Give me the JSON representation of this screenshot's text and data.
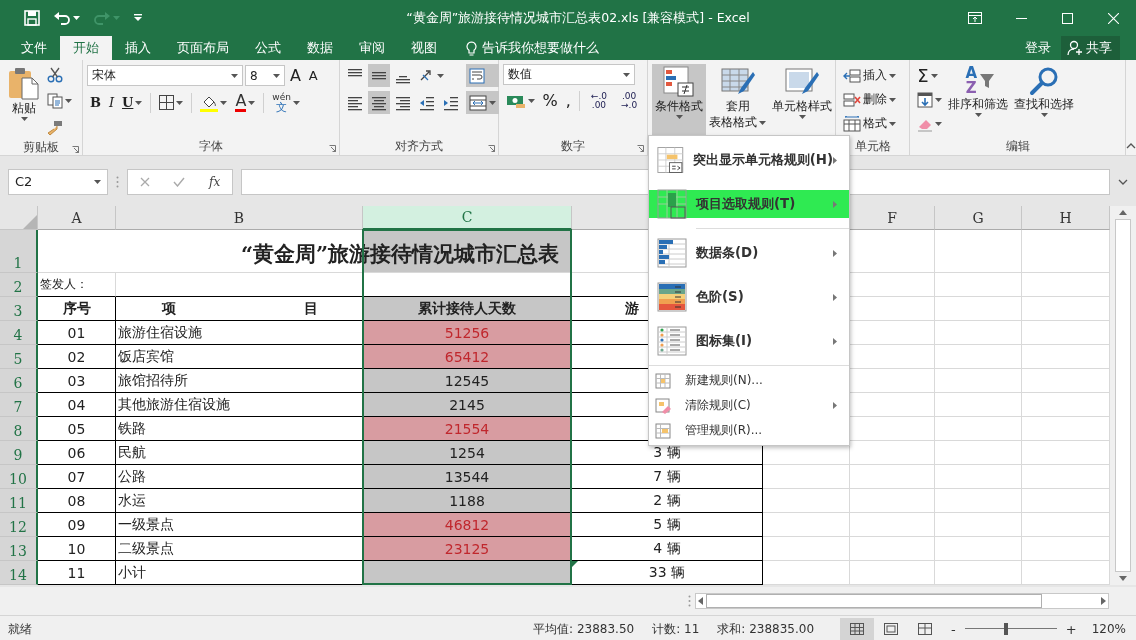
{
  "title_bar": {
    "title": "“黄金周”旅游接待情况城市汇总表02.xls  [兼容模式] - Excel"
  },
  "ribbon_tabs": [
    {
      "label": "文件",
      "selected": false
    },
    {
      "label": "开始",
      "selected": true
    },
    {
      "label": "插入",
      "selected": false
    },
    {
      "label": "页面布局",
      "selected": false
    },
    {
      "label": "公式",
      "selected": false
    },
    {
      "label": "数据",
      "selected": false
    },
    {
      "label": "审阅",
      "selected": false
    },
    {
      "label": "视图",
      "selected": false
    }
  ],
  "tell_me": "告诉我你想要做什么",
  "sign_in": "登录",
  "share": "共享",
  "ribbon": {
    "clipboard": {
      "paste": "粘贴",
      "group": "剪贴板"
    },
    "font": {
      "name": "宋体",
      "size": "8",
      "grow": "A",
      "shrink": "A",
      "bold": "B",
      "italic": "I",
      "underline": "U",
      "font_color": "A",
      "phonetic_top": "wén",
      "phonetic_bottom": "文",
      "group": "字体"
    },
    "alignment": {
      "top_row": [
        {
          "kind": "align-top",
          "pressed": false
        },
        {
          "kind": "align-middle",
          "pressed": true
        },
        {
          "kind": "align-bottom",
          "pressed": false
        },
        {
          "kind": "orientation",
          "pressed": false
        }
      ],
      "bottom_row": [
        {
          "kind": "align-left",
          "pressed": false
        },
        {
          "kind": "align-center",
          "pressed": true
        },
        {
          "kind": "align-right",
          "pressed": false
        },
        {
          "kind": "outdent",
          "pressed": false
        },
        {
          "kind": "indent",
          "pressed": false
        }
      ],
      "wrap_text": {
        "pressed": true
      },
      "merge": {
        "pressed": true
      },
      "group": "对齐方式"
    },
    "number": {
      "format": "数值",
      "percent": "%",
      "comma": ",",
      "decimal_increase": [
        "←.0",
        ".00"
      ],
      "decimal_decrease": [
        ".00",
        "→.0"
      ],
      "group": "数字"
    },
    "styles": {
      "conditional": "条件格式",
      "conditional_pressed": true,
      "table_top": "套用",
      "table_bottom": "表格格式",
      "cell_styles": "单元格样式"
    },
    "cells": {
      "insert": "插入",
      "delete": "删除",
      "format": "格式",
      "group": "单元格"
    },
    "editing": {
      "sum": "Σ",
      "sort_a": "A",
      "sort_z": "Z",
      "sort": "排序和筛选",
      "find": "查找和选择",
      "group": "编辑"
    }
  },
  "formula_bar": {
    "name_box": "C2",
    "fx": "fx"
  },
  "column_headers": [
    {
      "label": "A",
      "selected": false
    },
    {
      "label": "B",
      "selected": false
    },
    {
      "label": "C",
      "selected": true
    },
    {
      "label": "F",
      "selected": false
    },
    {
      "label": "G",
      "selected": false
    },
    {
      "label": "H",
      "selected": false
    }
  ],
  "rows": [
    {
      "number": "1",
      "kind": "title",
      "selected": true,
      "text": "“黄金周”旅游接待情况城市汇总表"
    },
    {
      "number": "2",
      "kind": "note",
      "selected": true,
      "text": "签发人："
    },
    {
      "number": "3",
      "kind": "header",
      "selected": true,
      "seq": "序号",
      "item_left": "项",
      "item_right": "目",
      "visits": "累计接待人天数",
      "vehicles": "游"
    },
    {
      "number": "4",
      "kind": "data",
      "selected": true,
      "seq": "01",
      "item": "旅游住宿设施",
      "visits": "51256",
      "highlighted": true
    },
    {
      "number": "5",
      "kind": "data",
      "selected": true,
      "seq": "02",
      "item": "饭店宾馆",
      "visits": "65412",
      "highlighted": true
    },
    {
      "number": "6",
      "kind": "data",
      "selected": true,
      "seq": "03",
      "item": "旅馆招待所",
      "visits": "12545",
      "highlighted": false
    },
    {
      "number": "7",
      "kind": "data",
      "selected": true,
      "seq": "04",
      "item": "其他旅游住宿设施",
      "visits": "2145",
      "highlighted": false
    },
    {
      "number": "8",
      "kind": "data",
      "selected": true,
      "seq": "05",
      "item": "铁路",
      "visits": "21554",
      "highlighted": true
    },
    {
      "number": "9",
      "kind": "data",
      "selected": true,
      "seq": "06",
      "item": "民航",
      "visits": "1254",
      "highlighted": false,
      "vehicles": "3 辆"
    },
    {
      "number": "10",
      "kind": "data",
      "selected": true,
      "seq": "07",
      "item": "公路",
      "visits": "13544",
      "highlighted": false,
      "vehicles": "7 辆"
    },
    {
      "number": "11",
      "kind": "data",
      "selected": true,
      "seq": "08",
      "item": "水运",
      "visits": "1188",
      "highlighted": false,
      "vehicles": "2 辆"
    },
    {
      "number": "12",
      "kind": "data",
      "selected": true,
      "seq": "09",
      "item": "一级景点",
      "visits": "46812",
      "highlighted": true,
      "vehicles": "5 辆"
    },
    {
      "number": "13",
      "kind": "data",
      "selected": true,
      "seq": "10",
      "item": "二级景点",
      "visits": "23125",
      "highlighted": true,
      "vehicles": "4 辆"
    },
    {
      "number": "14",
      "kind": "data",
      "selected": true,
      "seq": "11",
      "item": "小计",
      "highlighted": false,
      "vehicles": "33 辆",
      "error_flag": true
    }
  ],
  "menu": {
    "items": [
      {
        "kind": "large",
        "label": "突出显示单元格规则(H)",
        "submenu": true,
        "selected": false
      },
      {
        "kind": "large",
        "label": "项目选取规则(T)",
        "submenu": true,
        "selected": true
      },
      {
        "kind": "separator"
      },
      {
        "kind": "large",
        "label": "数据条(D)",
        "submenu": true,
        "selected": false
      },
      {
        "kind": "large",
        "label": "色阶(S)",
        "submenu": true,
        "selected": false
      },
      {
        "kind": "large",
        "label": "图标集(I)",
        "submenu": true,
        "selected": false
      },
      {
        "kind": "separator"
      },
      {
        "kind": "small",
        "label": "新建规则(N)...",
        "submenu": false,
        "selected": false
      },
      {
        "kind": "small",
        "label": "清除规则(C)",
        "submenu": true,
        "selected": false
      },
      {
        "kind": "small",
        "label": "管理规则(R)...",
        "submenu": false,
        "selected": false
      }
    ]
  },
  "status_bar": {
    "ready": "就绪",
    "average": "平均值: 23883.50",
    "count": "计数: 11",
    "sum": "求和: 238835.00",
    "views": [
      {
        "kind": "normal",
        "selected": true
      },
      {
        "kind": "page-layout",
        "selected": false
      },
      {
        "kind": "page-break",
        "selected": false
      }
    ],
    "zoom": {
      "minus": "-",
      "plus": "+",
      "level": 0.45,
      "percent": "120%"
    }
  }
}
